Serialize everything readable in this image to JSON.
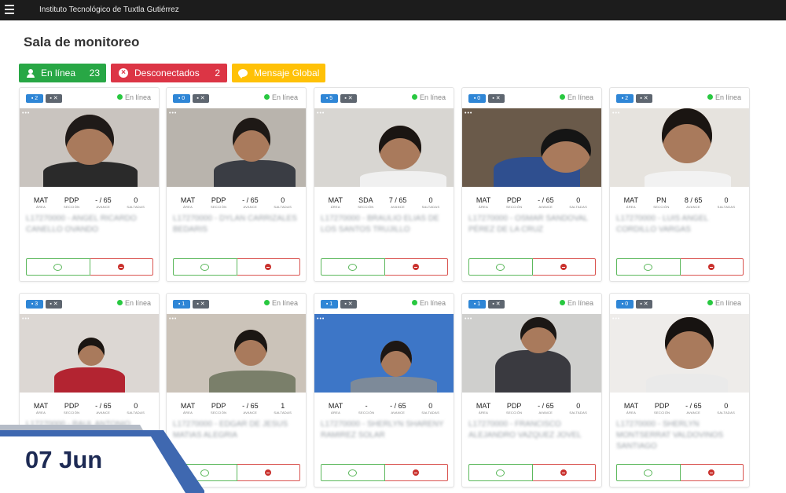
{
  "topbar": {
    "menu_icon": "hamburger-menu-icon",
    "title": "Instituto Tecnológico de Tuxtla Gutiérrez"
  },
  "page": {
    "title": "Sala de monitoreo"
  },
  "summary": {
    "online": {
      "label": "En línea",
      "count": "23",
      "icon": "user-icon",
      "color": "#28a745"
    },
    "disconnected": {
      "label": "Desconectados",
      "count": "2",
      "icon": "x-circle-icon",
      "color": "#dc3545"
    },
    "global_message": {
      "label": "Mensaje Global",
      "icon": "chat-bubble-icon",
      "color": "#ffc107"
    }
  },
  "stat_labels": {
    "area": "ÁREA",
    "seccion": "SECCIÓN",
    "avance": "AVANCE",
    "saltadas": "SALTADAS"
  },
  "status_label": "En línea",
  "cards": [
    {
      "badge": "2",
      "area": "MAT",
      "seccion": "PDP",
      "avance": "- / 65",
      "saltadas": "0",
      "name": "L17270000 - ANGEL RICARDO CANELLO OVANDO"
    },
    {
      "badge": "0",
      "area": "MAT",
      "seccion": "PDP",
      "avance": "- / 65",
      "saltadas": "0",
      "name": "L17270000 - DYLAN CARRIZALES BEDARIS"
    },
    {
      "badge": "5",
      "area": "MAT",
      "seccion": "SDA",
      "avance": "7 / 65",
      "saltadas": "0",
      "name": "L17270000 - BRAULIO ELIAS DE LOS SANTOS TRUJILLO"
    },
    {
      "badge": "0",
      "area": "MAT",
      "seccion": "PDP",
      "avance": "- / 65",
      "saltadas": "0",
      "name": "L17270000 - OSMAR SANDOVAL PÉREZ DE LA CRUZ"
    },
    {
      "badge": "2",
      "area": "MAT",
      "seccion": "PN",
      "avance": "8 / 65",
      "saltadas": "0",
      "name": "L17270000 - LUIS ANGEL CORDILLO VARGAS"
    },
    {
      "badge": "3",
      "area": "MAT",
      "seccion": "PDP",
      "avance": "- / 65",
      "saltadas": "0",
      "name": "L17270000 - RAUL ANTONIO PEREZ"
    },
    {
      "badge": "1",
      "area": "MAT",
      "seccion": "PDP",
      "avance": "- / 65",
      "saltadas": "1",
      "name": "L17270000 - EDGAR DE JESUS MATIAS ALEGRIA"
    },
    {
      "badge": "1",
      "area": "MAT",
      "seccion": "-",
      "avance": "- / 65",
      "saltadas": "0",
      "name": "L17270000 - SHERLYN SHARENY RAMIREZ SOLAR"
    },
    {
      "badge": "1",
      "area": "MAT",
      "seccion": "PDP",
      "avance": "- / 65",
      "saltadas": "0",
      "name": "L17270000 - FRANCISCO ALEJANDRO VAZQUEZ JOVEL"
    },
    {
      "badge": "0",
      "area": "MAT",
      "seccion": "PDP",
      "avance": "- / 65",
      "saltadas": "0",
      "name": "L17270000 - SHERLYN MONTSERRAT VALDOVINOS SANTIAGO"
    }
  ],
  "date_banner": {
    "text": "07 Jun",
    "colors": {
      "navy": "#1d2a54",
      "blue": "#3f68b0",
      "gray": "#b5bcc7"
    }
  }
}
